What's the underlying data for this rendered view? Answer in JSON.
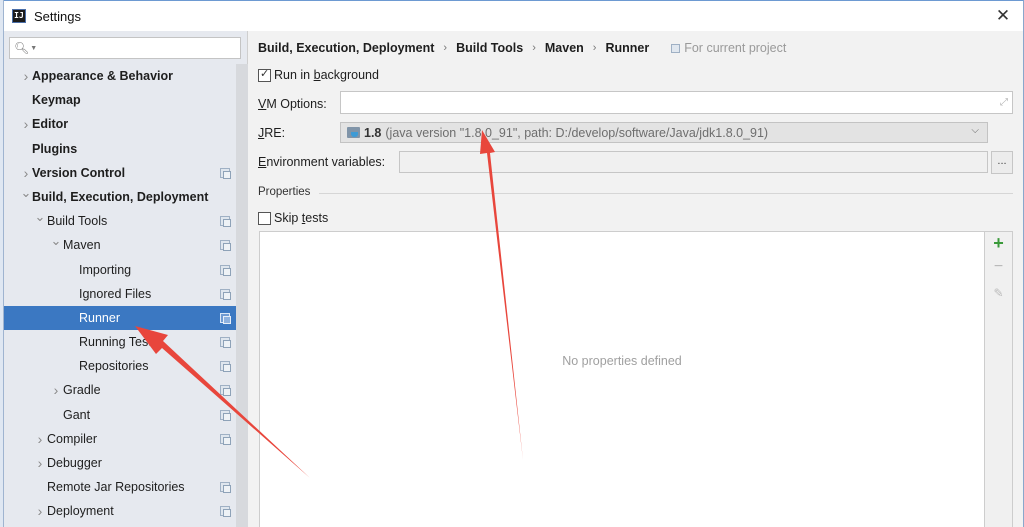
{
  "window": {
    "title": "Settings",
    "app_icon_text": "IJ",
    "close_label": "✕"
  },
  "sidebar": {
    "search": {
      "value": "",
      "placeholder": ""
    },
    "items": [
      {
        "label": "Appearance & Behavior",
        "level": 0,
        "bold": true,
        "chevron": "right",
        "project_icon": false,
        "selected": false
      },
      {
        "label": "Keymap",
        "level": 0,
        "bold": true,
        "chevron": null,
        "project_icon": false,
        "selected": false
      },
      {
        "label": "Editor",
        "level": 0,
        "bold": true,
        "chevron": "right",
        "project_icon": false,
        "selected": false
      },
      {
        "label": "Plugins",
        "level": 0,
        "bold": true,
        "chevron": null,
        "project_icon": false,
        "selected": false
      },
      {
        "label": "Version Control",
        "level": 0,
        "bold": true,
        "chevron": "right",
        "project_icon": true,
        "selected": false
      },
      {
        "label": "Build, Execution, Deployment",
        "level": 0,
        "bold": true,
        "chevron": "down",
        "project_icon": false,
        "selected": false
      },
      {
        "label": "Build Tools",
        "level": 1,
        "bold": false,
        "chevron": "down",
        "project_icon": true,
        "selected": false
      },
      {
        "label": "Maven",
        "level": 2,
        "bold": false,
        "chevron": "down",
        "project_icon": true,
        "selected": false
      },
      {
        "label": "Importing",
        "level": 3,
        "bold": false,
        "chevron": null,
        "project_icon": true,
        "selected": false
      },
      {
        "label": "Ignored Files",
        "level": 3,
        "bold": false,
        "chevron": null,
        "project_icon": true,
        "selected": false
      },
      {
        "label": "Runner",
        "level": 3,
        "bold": false,
        "chevron": null,
        "project_icon": true,
        "selected": true
      },
      {
        "label": "Running Tests",
        "level": 3,
        "bold": false,
        "chevron": null,
        "project_icon": true,
        "selected": false
      },
      {
        "label": "Repositories",
        "level": 3,
        "bold": false,
        "chevron": null,
        "project_icon": true,
        "selected": false
      },
      {
        "label": "Gradle",
        "level": 2,
        "bold": false,
        "chevron": "right",
        "project_icon": true,
        "selected": false
      },
      {
        "label": "Gant",
        "level": 2,
        "bold": false,
        "chevron": null,
        "project_icon": true,
        "selected": false
      },
      {
        "label": "Compiler",
        "level": 1,
        "bold": false,
        "chevron": "right",
        "project_icon": true,
        "selected": false
      },
      {
        "label": "Debugger",
        "level": 1,
        "bold": false,
        "chevron": "right",
        "project_icon": false,
        "selected": false
      },
      {
        "label": "Remote Jar Repositories",
        "level": 1,
        "bold": false,
        "chevron": null,
        "project_icon": true,
        "selected": false
      },
      {
        "label": "Deployment",
        "level": 1,
        "bold": false,
        "chevron": "right",
        "project_icon": true,
        "selected": false
      }
    ]
  },
  "main": {
    "breadcrumb": [
      "Build, Execution, Deployment",
      "Build Tools",
      "Maven",
      "Runner"
    ],
    "breadcrumb_separator": "›",
    "scope_label": "For current project",
    "run_in_background": {
      "label_prefix": "Run in ",
      "label_mnemonic": "b",
      "label_suffix": "ackground",
      "checked": true
    },
    "vm_options": {
      "label_mnemonic": "V",
      "label_suffix": "M Options:",
      "value": ""
    },
    "jre": {
      "label_mnemonic": "J",
      "label_suffix": "RE:",
      "selected_version": "1.8",
      "selected_detail": "(java version \"1.8.0_91\", path: D:/develop/software/Java/jdk1.8.0_91)"
    },
    "env_vars": {
      "label_mnemonic": "E",
      "label_suffix": "nvironment variables:",
      "value": "",
      "browse_label": "..."
    },
    "properties_section": "Properties",
    "skip_tests": {
      "label_prefix": "Skip ",
      "label_mnemonic": "t",
      "label_suffix": "ests",
      "checked": false
    },
    "properties_empty_text": "No properties defined",
    "toolbar": {
      "add": "+",
      "remove": "−",
      "edit": "✎"
    }
  },
  "annotations": {
    "arrow_color": "#e8463c",
    "arrows": [
      {
        "points_to": "sidebar Runner item"
      },
      {
        "points_to": "JRE version 1.8.0_91"
      }
    ]
  }
}
